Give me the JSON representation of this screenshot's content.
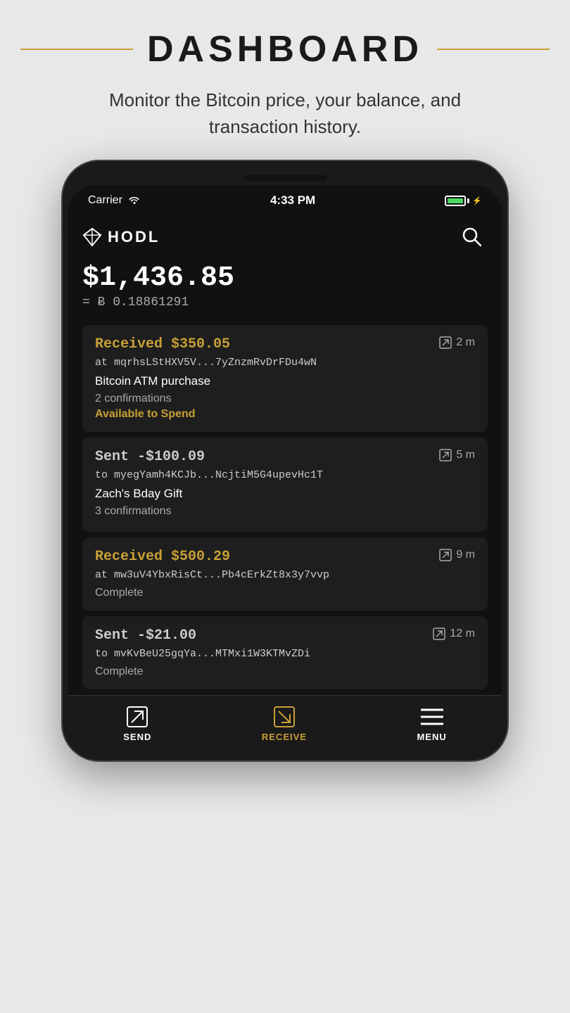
{
  "header": {
    "title": "DASHBOARD",
    "subtitle": "Monitor the Bitcoin price, your balance, and transaction history."
  },
  "status_bar": {
    "carrier": "Carrier",
    "time": "4:33 PM"
  },
  "app": {
    "logo_text": "HODL",
    "balance_usd": "$1,436.85",
    "balance_equals": "=",
    "balance_btc": "ɃΞ 0.18861291"
  },
  "transactions": [
    {
      "type": "received",
      "amount": "Received $350.05",
      "address": "at mqrhsLStHXV5V...7yZnzmRvDrFDu4wN",
      "label": "Bitcoin ATM purchase",
      "confirmations": "2 confirmations",
      "status": "Available to Spend",
      "time": "2 m",
      "arrow_direction": "in"
    },
    {
      "type": "sent",
      "amount": "Sent -$100.09",
      "address": "to myegYamh4KCJb...NcjtiM5G4upevHc1T",
      "label": "Zach's Bday Gift",
      "confirmations": "3 confirmations",
      "status": "",
      "time": "5 m",
      "arrow_direction": "out"
    },
    {
      "type": "received",
      "amount": "Received $500.29",
      "address": "at mw3uV4YbxRisCt...Pb4cErkZt8x3y7vvp",
      "label": "",
      "confirmations": "",
      "status": "Complete",
      "time": "9 m",
      "arrow_direction": "in"
    },
    {
      "type": "sent",
      "amount": "Sent -$21.00",
      "address": "to mvKvBeU25gqYa...MTMxi1W3KTMvZDi",
      "label": "",
      "confirmations": "",
      "status": "Complete",
      "time": "12 m",
      "arrow_direction": "out"
    }
  ],
  "nav": {
    "send": "SEND",
    "receive": "RECEIVE",
    "menu": "MENU"
  }
}
